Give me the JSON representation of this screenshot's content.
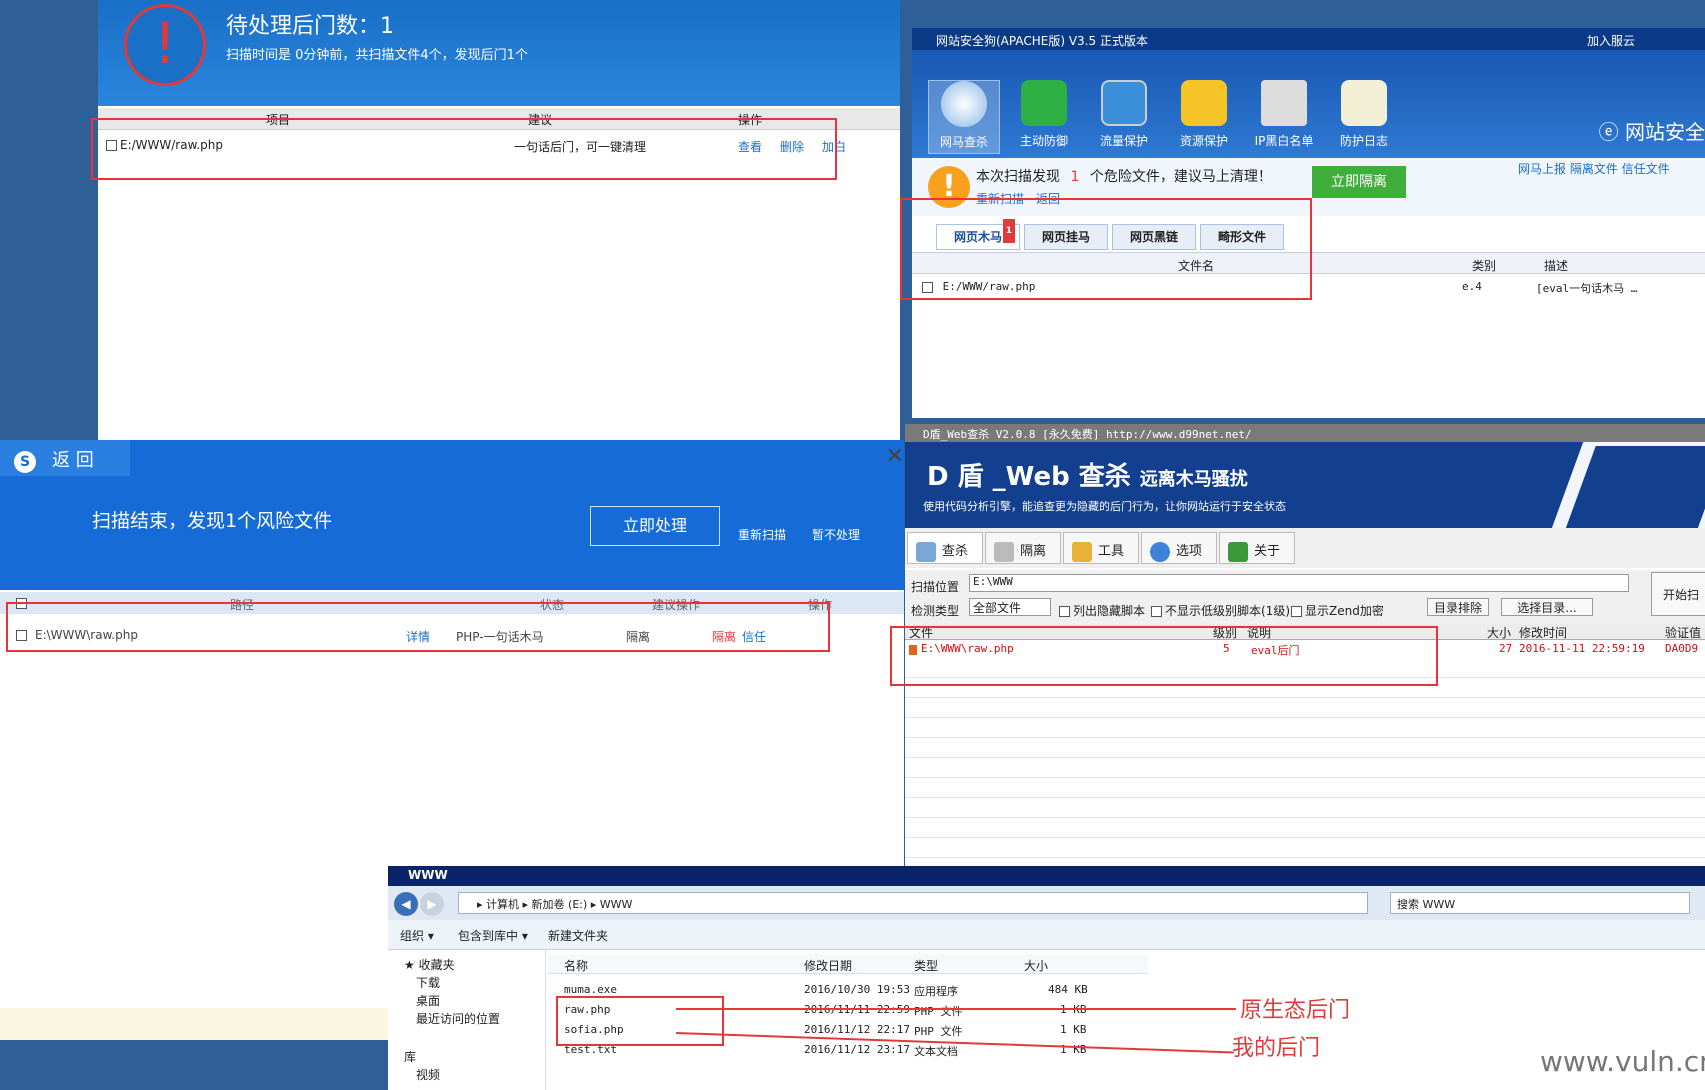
{
  "winA": {
    "title": "待处理后门数：1",
    "subtitle": "扫描时间是 0分钟前，共扫描文件4个，发现后门1个",
    "headers": [
      "项目",
      "建议",
      "操作"
    ],
    "row": {
      "file": "E:/WWW/raw.php",
      "advice": "一句话后门，可一键清理",
      "actions": [
        "查看",
        "删除",
        "加白"
      ]
    }
  },
  "winB": {
    "title": "网站安全狗(APACHE版) V3.5 正式版本",
    "topright": "加入服云",
    "tools": [
      "网马查杀",
      "主动防御",
      "流量保护",
      "资源保护",
      "IP黑白名单",
      "防护日志"
    ],
    "brand": "网站安全",
    "scan_msg_pre": "本次扫描发现",
    "scan_count": "1",
    "scan_msg_post": "个危险文件，建议马上清理！",
    "rescan": "重新扫描",
    "back": "返回",
    "isolate_btn": "立即隔离",
    "links": "网马上报  隔离文件  信任文件",
    "tabs": [
      "网页木马",
      "网页挂马",
      "网页黑链",
      "畸形文件"
    ],
    "tab_badge": "1",
    "cols": [
      "文件名",
      "类别",
      "描述"
    ],
    "row": {
      "file": "E:/WWW/raw.php",
      "cat": "e.4",
      "desc": "[eval一句话木马 …"
    }
  },
  "winC": {
    "back": "返 回",
    "logo": "S",
    "message": "扫描结束，发现1个风险文件",
    "primary": "立即处理",
    "rescan": "重新扫描",
    "skip": "暂不处理",
    "headers": [
      "路径",
      "状态",
      "建议操作",
      "操作"
    ],
    "row": {
      "path": "E:\\WWW\\raw.php",
      "detail": "详情",
      "status": "PHP-一句话木马",
      "suggest": "隔离",
      "act1": "隔离",
      "act2": "信任"
    }
  },
  "winD": {
    "title": "D盾_Web查杀 V2.0.8 [永久免费] http://www.d99net.net/",
    "brand": "D 盾 _Web 查杀",
    "brand2": "远离木马骚扰",
    "desc": "使用代码分析引擎，能追查更为隐藏的后门行为，让你网站运行于安全状态",
    "tools": [
      "查杀",
      "隔离",
      "工具",
      "选项",
      "关于"
    ],
    "scan_label": "扫描位置",
    "scan_value": "E:\\WWW",
    "type_label": "检测类型",
    "type_value": "全部文件",
    "opt1": "列出隐藏脚本",
    "opt2": "不显示低级别脚本(1级)",
    "opt3": "显示Zend加密",
    "dir_exclude": "目录排除",
    "choose_dir": "选择目录...",
    "start": "开始扫",
    "cols": [
      "文件",
      "级别",
      "说明",
      "大小",
      "修改时间",
      "验证值"
    ],
    "row": {
      "file": "E:\\WWW\\raw.php",
      "level": "5",
      "desc": "eval后门",
      "size": "27",
      "time": "2016-11-11 22:59:19",
      "hash": "DA0D9"
    }
  },
  "winE": {
    "title": "WWW",
    "path": "▸ 计算机 ▸ 新加卷 (E:) ▸ WWW",
    "search": "搜索 WWW",
    "menu": [
      "组织 ▾",
      "包含到库中 ▾",
      "新建文件夹"
    ],
    "side": [
      "收藏夹",
      "下载",
      "桌面",
      "最近访问的位置",
      "库",
      "视频"
    ],
    "cols": [
      "名称",
      "修改日期",
      "类型",
      "大小"
    ],
    "files": [
      {
        "name": "muma.exe",
        "date": "2016/10/30 19:53",
        "type": "应用程序",
        "size": "484 KB"
      },
      {
        "name": "raw.php",
        "date": "2016/11/11 22:59",
        "type": "PHP 文件",
        "size": "1 KB"
      },
      {
        "name": "sofia.php",
        "date": "2016/11/12 22:17",
        "type": "PHP 文件",
        "size": "1 KB"
      },
      {
        "name": "test.txt",
        "date": "2016/11/12 23:17",
        "type": "文本文档",
        "size": "1 KB"
      }
    ]
  },
  "annotations": {
    "original": "原生态后门",
    "mine": "我的后门"
  },
  "watermark": "www.vuln.cn",
  "colors": {
    "accent": "#e8333a",
    "blue360": "#176bd6",
    "safedog": "#1858b4",
    "dshield": "#123f8e"
  }
}
